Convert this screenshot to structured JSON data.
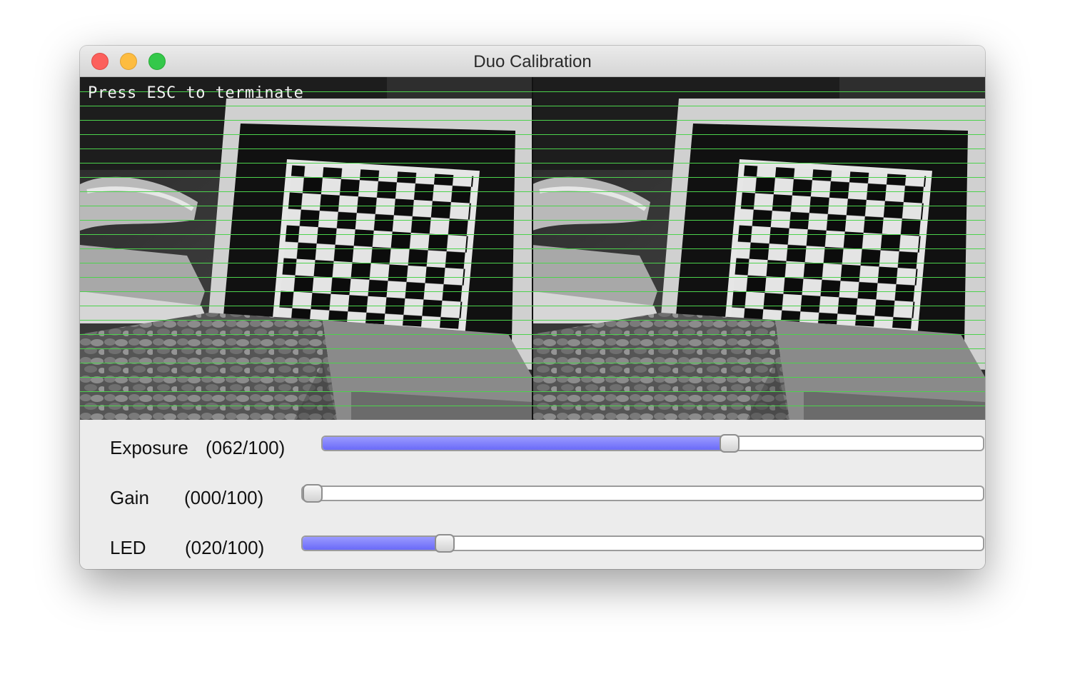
{
  "window": {
    "title": "Duo Calibration"
  },
  "video": {
    "overlay_text": "Press ESC to terminate",
    "guide_line_color": "#4cd24c"
  },
  "controls": [
    {
      "name": "Exposure",
      "value_text": "(062/100)",
      "value": 62,
      "max": 100
    },
    {
      "name": "Gain",
      "value_text": "(000/100)",
      "value": 0,
      "max": 100
    },
    {
      "name": "LED",
      "value_text": "(020/100)",
      "value": 20,
      "max": 100
    }
  ],
  "colors": {
    "slider_fill": "#6a6af8",
    "close": "#fc605c",
    "minimize": "#fdbc40",
    "maximize": "#34c84a"
  }
}
